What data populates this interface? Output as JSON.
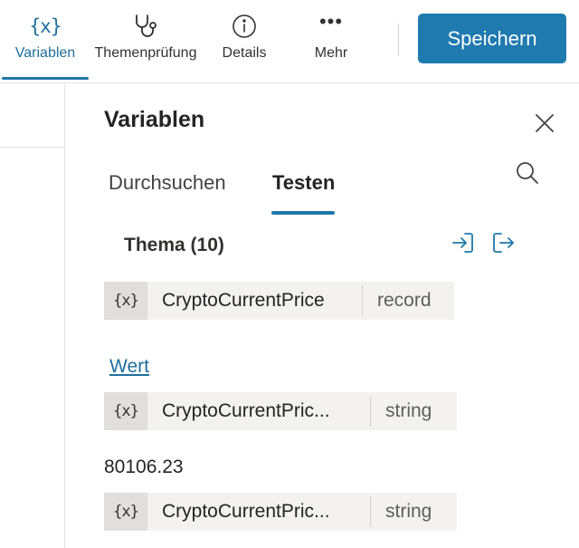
{
  "toolbar": {
    "items": [
      {
        "label": "Variablen",
        "icon": "{x}",
        "icon_name": "variables-icon",
        "active": true
      },
      {
        "label": "Themenprüfung",
        "icon_name": "stethoscope-icon",
        "active": false
      },
      {
        "label": "Details",
        "icon_name": "info-icon",
        "active": false
      },
      {
        "label": "Mehr",
        "icon": "•••",
        "icon_name": "more-icon",
        "active": false
      }
    ],
    "save_label": "Speichern",
    "accent_color": "#1f7ab0"
  },
  "panel": {
    "title": "Variablen",
    "tabs": [
      {
        "label": "Durchsuchen",
        "active": false
      },
      {
        "label": "Testen",
        "active": true
      }
    ],
    "section": {
      "title": "Thema (10)"
    },
    "variables": [
      {
        "icon": "{x}",
        "name": "CryptoCurrentPrice",
        "type": "record"
      },
      {
        "icon": "{x}",
        "name": "CryptoCurrentPric...",
        "type": "string"
      },
      {
        "icon": "{x}",
        "name": "CryptoCurrentPric...",
        "type": "string"
      }
    ],
    "value_link": "Wert",
    "value_text": "80106.23"
  }
}
